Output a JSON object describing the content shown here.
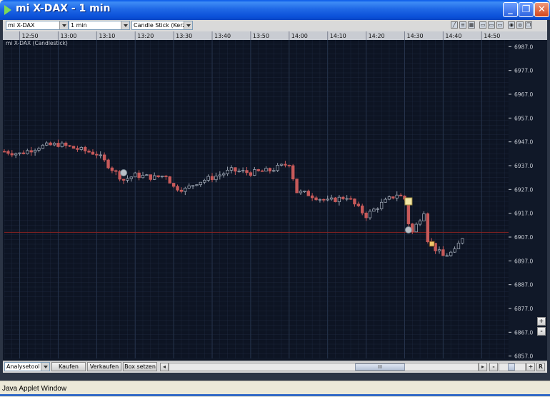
{
  "window": {
    "title": "mi X-DAX - 1 min",
    "minimize": "_",
    "maximize": "❐",
    "close": "✕"
  },
  "toolbar": {
    "instrument": "mi X-DAX",
    "interval": "1 min",
    "chart_type": "Candle Stick (Kerze",
    "tools": [
      "pencil-icon",
      "list-icon",
      "grid-icon",
      "window-icon",
      "window-icon",
      "window-icon",
      "settings-icon",
      "zoom-icon",
      "restore-icon"
    ]
  },
  "chart": {
    "label": "mi X-DAX (Candlestick)",
    "colors": {
      "bg": "#0d1423",
      "grid": "#26344c",
      "up": "#9aa3b0",
      "down": "#c85a5a",
      "hline": "#8a2222",
      "axis_text": "#c8ccd4"
    }
  },
  "chart_data": {
    "type": "candlestick",
    "title": "mi X-DAX (Candlestick)",
    "x_tick_labels": [
      "12:50",
      "13:00",
      "13:10",
      "13:20",
      "13:30",
      "13:40",
      "13:50",
      "14:00",
      "14:10",
      "14:20",
      "14:30",
      "14:40",
      "14:50"
    ],
    "y_tick_labels": [
      "6987.0",
      "6977.0",
      "6967.0",
      "6957.0",
      "6947.0",
      "6937.0",
      "6927.0",
      "6917.0",
      "6907.0",
      "6897.0",
      "6887.0",
      "6877.0",
      "6867.0",
      "6857.0"
    ],
    "ylim": [
      6856,
      6991
    ],
    "reference_line": 6909,
    "close_path": [
      [
        "12:46",
        6943
      ],
      [
        "12:50",
        6942
      ],
      [
        "12:55",
        6945
      ],
      [
        "13:00",
        6946
      ],
      [
        "13:05",
        6944
      ],
      [
        "13:10",
        6942
      ],
      [
        "13:15",
        6934
      ],
      [
        "13:17",
        6931
      ],
      [
        "13:20",
        6933
      ],
      [
        "13:25",
        6932
      ],
      [
        "13:28",
        6933
      ],
      [
        "13:30",
        6928
      ],
      [
        "13:33",
        6927
      ],
      [
        "13:36",
        6930
      ],
      [
        "13:40",
        6932
      ],
      [
        "13:45",
        6935
      ],
      [
        "13:50",
        6934
      ],
      [
        "13:55",
        6935
      ],
      [
        "14:00",
        6938
      ],
      [
        "14:02",
        6926
      ],
      [
        "14:05",
        6925
      ],
      [
        "14:10",
        6922
      ],
      [
        "14:15",
        6924
      ],
      [
        "14:18",
        6919
      ],
      [
        "14:20",
        6916
      ],
      [
        "14:24",
        6921
      ],
      [
        "14:28",
        6925
      ],
      [
        "14:30",
        6923
      ],
      [
        "14:31",
        6913
      ],
      [
        "14:32",
        6909
      ],
      [
        "14:35",
        6918
      ],
      [
        "14:36",
        6906
      ],
      [
        "14:38",
        6902
      ],
      [
        "14:40",
        6899
      ],
      [
        "14:43",
        6901
      ],
      [
        "14:45",
        6907
      ]
    ],
    "markers": [
      {
        "time": "13:17",
        "price": 6934,
        "kind": "circle"
      },
      {
        "time": "14:31",
        "price": 6922,
        "kind": "square"
      },
      {
        "time": "14:31",
        "price": 6910,
        "kind": "circle"
      },
      {
        "time": "14:37",
        "price": 6904,
        "kind": "flag"
      }
    ]
  },
  "bottom": {
    "analysis_tool": "Analysetool",
    "buy": "Kaufen",
    "sell": "Verkaufen",
    "set_box": "Box setzen",
    "thumb": "III",
    "zoom_out": "-",
    "zoom_in": "+",
    "reset": "R",
    "side_plus": "+",
    "side_minus": "-"
  },
  "status": {
    "text": "Java Applet Window"
  }
}
